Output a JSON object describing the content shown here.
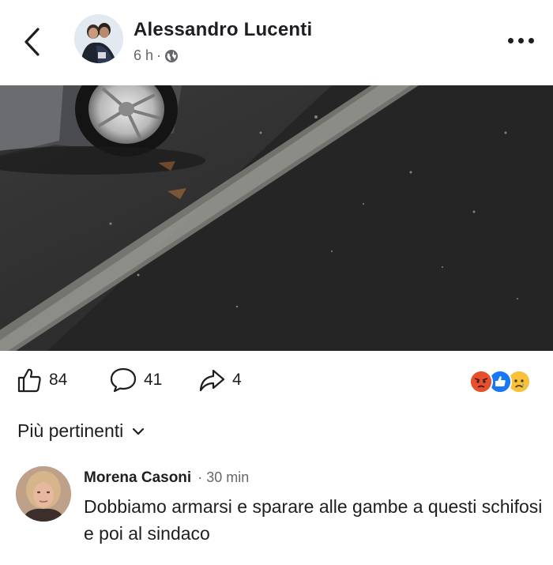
{
  "post": {
    "author": "Alessandro Lucenti",
    "time": "6 h",
    "separator": "·",
    "audience_icon": "globe-icon"
  },
  "reactions": {
    "likes": "84",
    "comments": "41",
    "shares": "4",
    "types": [
      "angry",
      "like",
      "sad"
    ]
  },
  "sort": {
    "label": "Più pertinenti"
  },
  "comment": {
    "author": "Morena Casoni",
    "time": "· 30 min",
    "text": "Dobbiamo armarsi e sparare alle gambe a questi schifosi e poi al sindaco"
  },
  "colors": {
    "text": "#1c1e21",
    "secondary": "#65676b",
    "like_blue": "#1877f2",
    "angry": "#e9710f",
    "sad": "#f7b125"
  }
}
